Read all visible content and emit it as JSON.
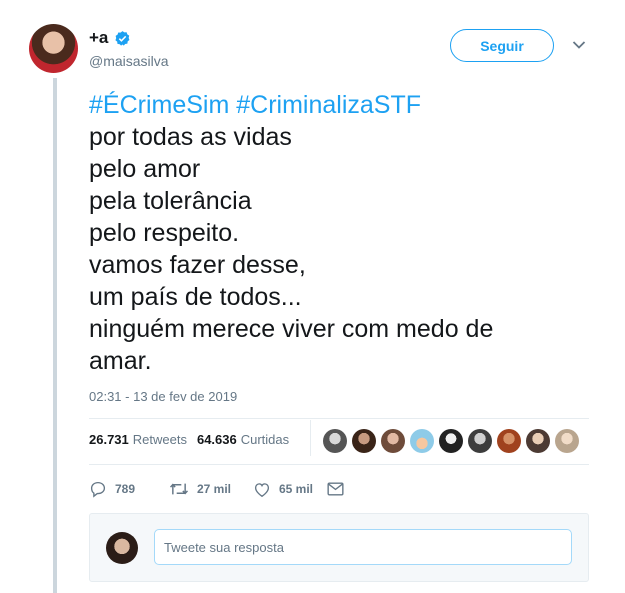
{
  "author": {
    "display_name": "+a",
    "handle": "@maisasilva",
    "verified_icon": "verified-badge-icon"
  },
  "follow_label": "Seguir",
  "tweet": {
    "hashtags": [
      "#ÉCrimeSim",
      "#CriminalizaSTF"
    ],
    "lines": [
      "por todas as vidas",
      "pelo amor",
      "pela tolerância",
      "pelo respeito.",
      "vamos fazer desse,",
      "um país de todos...",
      "ninguém merece viver com medo de",
      "amar."
    ],
    "timestamp": "02:31 - 13 de fev de 2019"
  },
  "stats": {
    "retweets_count": "26.731",
    "retweets_label": "Retweets",
    "likes_count": "64.636",
    "likes_label": "Curtidas"
  },
  "actions": {
    "replies": "789",
    "retweets": "27 mil",
    "likes": "65 mil"
  },
  "reply": {
    "placeholder": "Tweete sua resposta"
  },
  "colors": {
    "accent": "#1da1f2",
    "text": "#14171a",
    "muted": "#657786"
  }
}
